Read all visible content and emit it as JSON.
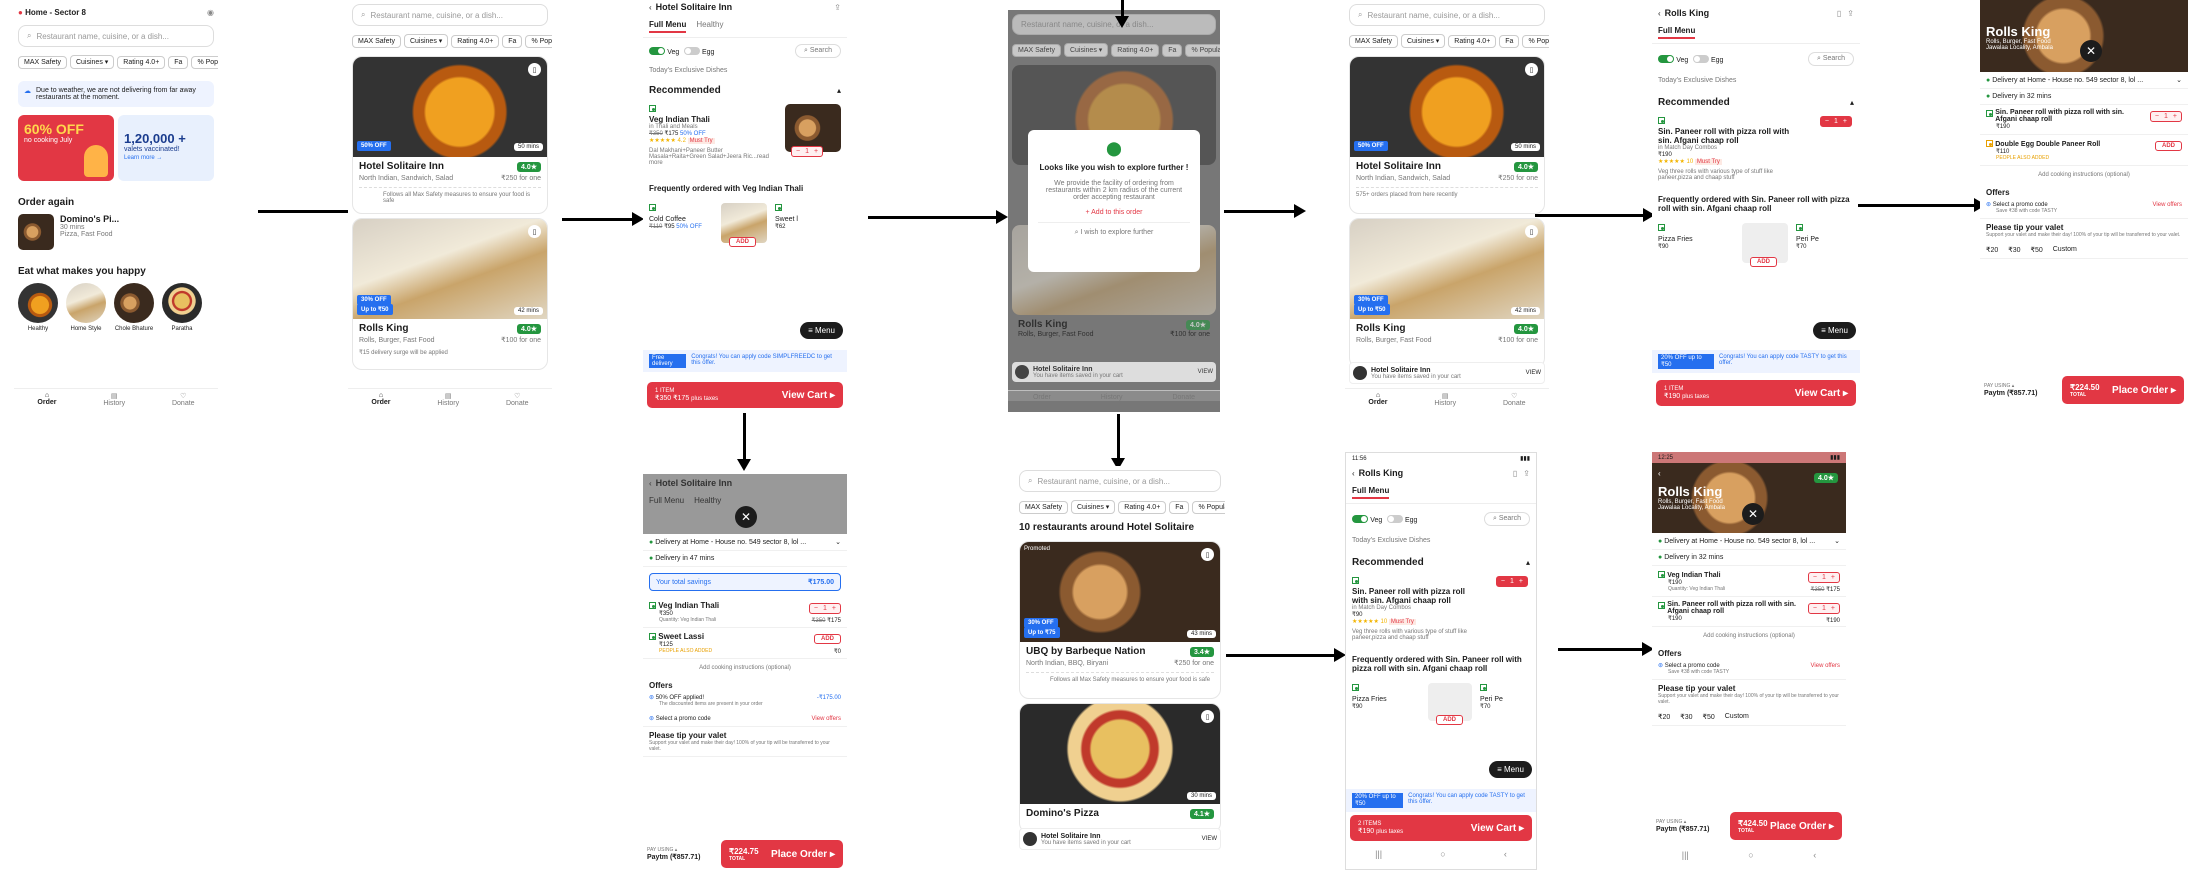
{
  "s1": {
    "location": "Home - Sector 8",
    "search_placeholder": "Restaurant name, cuisine, or a dish...",
    "filters": [
      "MAX Safety",
      "Cuisines ▾",
      "Rating 4.0+",
      "Fa",
      "% Popular"
    ],
    "weather": "Due to weather, we are not delivering from far away restaurants at the moment.",
    "banner1": "60% OFF",
    "banner1_sub": "no cooking July",
    "banner2": "1,20,000 +",
    "banner2_sub": "valets vaccinated!",
    "banner2_link": "Learn more →",
    "order_again": "Order again",
    "oa_name": "Domino's Pi...",
    "oa_time": "30 mins",
    "oa_cuisine": "Pizza, Fast Food",
    "eat": "Eat what makes you happy",
    "dishes": [
      "Healthy",
      "Home Style",
      "Chole Bhature",
      "Paratha"
    ],
    "nav": [
      "Order",
      "History",
      "Donate"
    ]
  },
  "s2": {
    "search_placeholder": "Restaurant name, cuisine, or a dish...",
    "filters": [
      "MAX Safety",
      "Cuisines ▾",
      "Rating 4.0+",
      "Fa",
      "% Popular"
    ],
    "r1_name": "Hotel Solitaire Inn",
    "r1_rating": "4.0★",
    "r1_cuisine": "North Indian, Sandwich, Salad",
    "r1_price": "₹250 for one",
    "r1_offer": "50% OFF",
    "r1_mins": "50 mins",
    "r1_safety": "Follows all Max Safety measures to ensure your food is safe",
    "r2_name": "Rolls King",
    "r2_rating": "4.0★",
    "r2_cuisine": "Rolls, Burger, Fast Food",
    "r2_price": "₹100 for one",
    "r2_offer": "30% OFF",
    "r2_offer2": "Up to ₹50",
    "r2_mins": "42 mins",
    "r2_surge": "₹15 delivery surge will be applied",
    "nav": [
      "Order",
      "History",
      "Donate"
    ]
  },
  "s3": {
    "title": "Hotel Solitaire Inn",
    "tabs": [
      "Full Menu",
      "Healthy"
    ],
    "veg": "Veg",
    "egg": "Egg",
    "search": "Search",
    "exclusive": "Today's Exclusive Dishes",
    "recommended": "Recommended",
    "item_name": "Veg Indian Thali",
    "item_desc": "in Thali and Meals",
    "item_price_old": "₹350",
    "item_price": "₹175",
    "item_off": "50% OFF",
    "item_rating": "★★★★★ 4.2",
    "item_tag": "Must Try",
    "item_detail": "Dal Makhani+Paneer Butter Masala+Raita+Green Salad+Jeera Ric...read more",
    "qty": "1",
    "freq": "Frequently ordered with Veg Indian Thali",
    "f1": "Cold Coffee",
    "f1_old": "₹110",
    "f1_price": "₹95",
    "f1_off": "50% OFF",
    "f2": "Sweet l",
    "f2_price": "₹62",
    "menu": "Menu",
    "free": "Free delivery",
    "free_msg": "Congrats! You can apply code SIMPLFREEDC to get this offer.",
    "cart_items": "1 ITEM",
    "cart_price": "₹350 ₹175",
    "cart_tax": "plus taxes",
    "view_cart": "View Cart ▸"
  },
  "s4": {
    "search_placeholder": "Restaurant name, cuisine, or a dish...",
    "filters": [
      "MAX Safety",
      "Cuisines ▾",
      "Rating 4.0+",
      "Fa",
      "% Popular"
    ],
    "modal_title": "Looks like you wish to explore further !",
    "modal_body": "We provide the facility of ordering from restaurants within 2 km radius of the current order accepting restaurant",
    "add": "+ Add to this order",
    "explore": "I wish to explore further",
    "r_name": "Rolls King",
    "r_rating": "4.0★",
    "r_cuisine": "Rolls, Burger, Fast Food",
    "r_price": "₹100 for one",
    "hotel": "Hotel Solitaire Inn",
    "hotel_sub": "You have items saved in your cart",
    "view": "VIEW",
    "nav": [
      "Order",
      "History",
      "Donate"
    ]
  },
  "s5": {
    "search_placeholder": "Restaurant name, cuisine, or a dish...",
    "filters": [
      "MAX Safety",
      "Cuisines ▾",
      "Rating 4.0+",
      "Fa",
      "% Popular"
    ],
    "r1_name": "Hotel Solitaire Inn",
    "r1_rating": "4.0★",
    "r1_cuisine": "North Indian, Sandwich, Salad",
    "r1_price": "₹250 for one",
    "r1_offer": "50% OFF",
    "r1_mins": "50 mins",
    "r1_orders": "575+ orders placed from here recently",
    "r2_name": "Rolls King",
    "r2_rating": "4.0★",
    "r2_cuisine": "Rolls, Burger, Fast Food",
    "r2_price": "₹100 for one",
    "r2_offer": "30% OFF",
    "r2_offer2": "Up to ₹50",
    "r2_mins": "42 mins",
    "hotel": "Hotel Solitaire Inn",
    "hotel_sub": "You have items saved in your cart",
    "view": "VIEW",
    "nav": [
      "Order",
      "History",
      "Donate"
    ]
  },
  "s6": {
    "title": "Rolls King",
    "tab": "Full Menu",
    "veg": "Veg",
    "egg": "Egg",
    "search": "Search",
    "exclusive": "Today's Exclusive Dishes",
    "recommended": "Recommended",
    "item_name": "Sin. Paneer roll with pizza roll with sin. Afgani chaap roll",
    "item_cat": "in Match Day Combos",
    "item_price": "₹190",
    "item_rating": "★★★★★ 10",
    "item_tag": "Must Try",
    "item_detail": "Veg three rolls with various type of stuff like paneer,pizza and chaap stuff",
    "qty": "1",
    "freq": "Frequently ordered with Sin. Paneer roll with pizza roll with sin. Afgani chaap roll",
    "f1": "Pizza Fries",
    "f1_price": "₹90",
    "f2": "Peri Pe",
    "f2_price": "₹70",
    "menu": "Menu",
    "promo": "20% OFF up to ₹50",
    "promo_msg": "Congrats! You can apply code TASTY to get this offer.",
    "cart_items": "1 ITEM",
    "cart_price": "₹190",
    "cart_tax": "plus taxes",
    "view_cart": "View Cart ▸"
  },
  "s7": {
    "title": "Rolls King",
    "cuisine": "Rolls, Burger, Fast Food",
    "locality": "Jawalaa Locality, Ambala",
    "delivery": "Delivery at Home - House no. 549 sector 8, lol ...",
    "time": "Delivery in 32 mins",
    "i1": "Sin. Paneer roll with pizza roll with sin. Afgani chaap roll",
    "i1_qty": "1",
    "i1_price": "₹190",
    "i2": "Double Egg Double Paneer Roll",
    "i2_price": "₹110",
    "i2_tag": "PEOPLE ALSO ADDED",
    "add_label": "ADD",
    "instructions": "Add cooking instructions (optional)",
    "offers": "Offers",
    "promo": "Select a promo code",
    "promo_sub": "Save ₹38 with code TASTY",
    "view_offers": "View offers",
    "tip": "Please tip your valet",
    "tip_sub": "Support your valet and make their day! 100% of your tip will be transferred to your valet.",
    "tips": [
      "₹20",
      "₹30",
      "₹50",
      "Custom"
    ],
    "pay": "PAY USING ▴",
    "wallet": "Paytm (₹857.71)",
    "total": "₹224.50",
    "total_label": "TOTAL",
    "place": "Place Order ▸"
  },
  "s8": {
    "title": "Hotel Solitaire Inn",
    "tabs": [
      "Full Menu",
      "Healthy"
    ],
    "delivery": "Delivery at Home - House no. 549 sector 8, lol ...",
    "time": "Delivery in 47 mins",
    "savings": "Your total savings",
    "savings_val": "₹175.00",
    "i1": "Veg Indian Thali",
    "i1_price": "₹350",
    "i1_old": "₹350",
    "i1_new": "₹175",
    "i1_qty": "1",
    "i1_sub": "Quantity: Veg Indian Thali",
    "i2": "Sweet Lassi",
    "i2_price": "₹125",
    "i2_zero": "₹0",
    "i2_tag": "PEOPLE ALSO ADDED",
    "add_label": "ADD",
    "instructions": "Add cooking instructions (optional)",
    "offers": "Offers",
    "o1": "50% OFF applied!",
    "o1_val": "-₹175.00",
    "o1_sub": "The discounted items are present in your order",
    "promo": "Select a promo code",
    "view_offers": "View offers",
    "tip": "Please tip your valet",
    "tip_sub": "Support your valet and make their day! 100% of your tip will be transferred to your valet.",
    "pay": "PAY USING ▴",
    "wallet": "Paytm (₹857.71)",
    "total": "₹224.75",
    "total_label": "TOTAL",
    "place": "Place Order ▸"
  },
  "s9": {
    "search_placeholder": "Restaurant name, cuisine, or a dish...",
    "filters": [
      "MAX Safety",
      "Cuisines ▾",
      "Rating 4.0+",
      "Fa",
      "% Popular"
    ],
    "heading": "10 restaurants around Hotel Solitaire",
    "r1_name": "UBQ by Barbeque Nation",
    "r1_rating": "3.4★",
    "r1_cuisine": "North Indian, BBQ, Biryani",
    "r1_price": "₹250 for one",
    "r1_offer": "30% OFF",
    "r1_offer2": "Up to ₹75",
    "r1_mins": "43 mins",
    "r1_promoted": "Promoted",
    "r1_safety": "Follows all Max Safety measures to ensure your food is safe",
    "r2_name": "Domino's Pizza",
    "r2_rating": "4.1★",
    "r2_mins": "30 mins",
    "hotel": "Hotel Solitaire Inn",
    "hotel_sub": "You have items saved in your cart",
    "view": "VIEW"
  },
  "s10": {
    "status_time": "11:56",
    "title": "Rolls King",
    "tab": "Full Menu",
    "veg": "Veg",
    "egg": "Egg",
    "search": "Search",
    "exclusive": "Today's Exclusive Dishes",
    "recommended": "Recommended",
    "item_name": "Sin. Paneer roll with pizza roll with sin. Afgani chaap roll",
    "item_cat": "in Match Day Combos",
    "item_price": "₹90",
    "item_rating": "★★★★★ 10",
    "item_tag": "Must Try",
    "item_detail": "Veg three rolls with various type of stuff like paneer,pizza and chaap stuff",
    "qty": "1",
    "freq": "Frequently ordered with Sin. Paneer roll with pizza roll with sin. Afgani chaap roll",
    "f1": "Pizza Fries",
    "f1_price": "₹90",
    "f2": "Peri Pe",
    "f2_price": "₹70",
    "menu": "Menu",
    "promo": "20% OFF up to ₹50",
    "promo_msg": "Congrats! You can apply code TASTY to get this offer.",
    "cart_items": "2 ITEMS",
    "cart_price": "₹190",
    "cart_tax": "plus taxes",
    "view_cart": "View Cart ▸"
  },
  "s11": {
    "status_time": "12:25",
    "title": "Rolls King",
    "rating": "4.0★",
    "cuisine": "Rolls, Burger, Fast Food",
    "locality": "Jawalaa Locality, Ambala",
    "delivery": "Delivery at Home - House no. 549 sector 8, lol ...",
    "time": "Delivery in 32 mins",
    "i1": "Veg Indian Thali",
    "i1_qty": "1",
    "i1_old": "₹350",
    "i1_new": "₹175",
    "i1_sub": "Quantity: Veg Indian Thali",
    "i1_price": "₹190",
    "i2": "Sin. Paneer roll with pizza roll with sin. Afgani chaap roll",
    "i2_qty": "1",
    "i2_price": "₹190",
    "i2_val": "₹190",
    "instructions": "Add cooking instructions (optional)",
    "offers": "Offers",
    "promo": "Select a promo code",
    "promo_sub": "Save ₹38 with code TASTY",
    "view_offers": "View offers",
    "tip": "Please tip your valet",
    "tip_sub": "Support your valet and make their day! 100% of your tip will be transferred to your valet.",
    "tips": [
      "₹20",
      "₹30",
      "₹50",
      "Custom"
    ],
    "pay": "PAY USING ▴",
    "wallet": "Paytm (₹857.71)",
    "total": "₹424.50",
    "total_label": "TOTAL",
    "place": "Place Order ▸"
  }
}
